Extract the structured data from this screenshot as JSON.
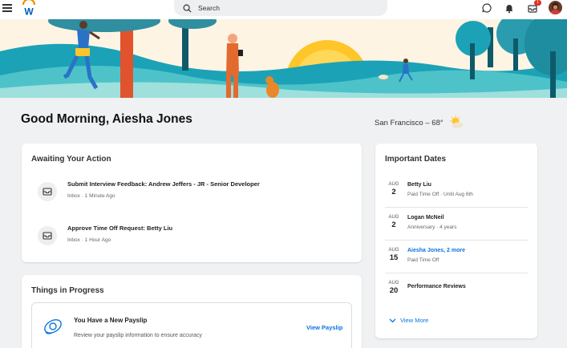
{
  "app": {
    "logo": "W"
  },
  "topbar": {
    "search_placeholder": "Search",
    "icons": [
      "menu-icon",
      "search-icon",
      "chat-icon",
      "bell-icon",
      "inbox-icon",
      "avatar"
    ],
    "inbox_badge": "1"
  },
  "greeting": "Good Morning, Aiesha Jones",
  "weather": {
    "text": "San Francisco – 68°",
    "icon": "partly-sunny-icon"
  },
  "awaiting": {
    "title": "Awaiting Your Action",
    "items": [
      {
        "title": "Submit Interview Feedback: Andrew Jeffers - JR - Senior Developer",
        "subtitle": "Inbox · 1 Minute Ago",
        "icon": "inbox-tray-icon"
      },
      {
        "title": "Approve Time Off Request: Betty Liu",
        "subtitle": "Inbox · 1 Hour Ago",
        "icon": "inbox-tray-icon"
      }
    ]
  },
  "progress": {
    "title": "Things in Progress",
    "item": {
      "title": "You Have a New Payslip",
      "subtitle": "Review your payslip information to ensure accuracy",
      "link": "View Payslip",
      "icon": "payslip-icon"
    }
  },
  "important_dates": {
    "title": "Important Dates",
    "items": [
      {
        "month": "AUG",
        "day": "2",
        "name": "Betty Liu",
        "detail": "Paid Time Off · Until Aug 6th"
      },
      {
        "month": "AUG",
        "day": "2",
        "name": "Logan McNeil",
        "detail": "Anniversary · 4 years"
      },
      {
        "month": "AUG",
        "day": "15",
        "name": "Aiesha Jones, 2 more",
        "detail": "Paid Time Off"
      },
      {
        "month": "AUG",
        "day": "20",
        "name": "Performance Reviews",
        "detail": ""
      }
    ],
    "view_more": "View More"
  },
  "colors": {
    "accent_blue": "#0875e1",
    "badge_red": "#de2e21",
    "banner_teal": "#1ca2b7",
    "banner_sun": "#ffc629"
  }
}
